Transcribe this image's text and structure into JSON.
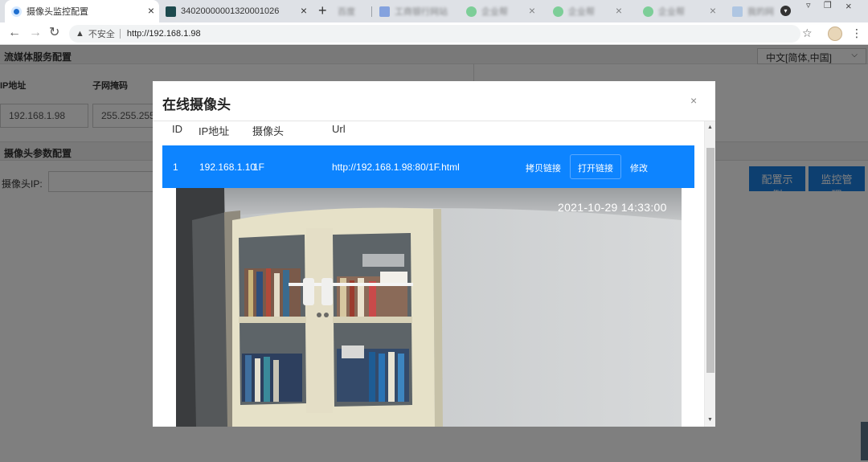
{
  "browser": {
    "tabs": [
      {
        "title": "摄像头监控配置",
        "active": true
      },
      {
        "title": "340200000013200010​26"
      },
      {
        "title": "百度"
      },
      {
        "title": "工商银行网站"
      },
      {
        "title": "企业帮"
      },
      {
        "title": "企业帮"
      },
      {
        "title": "企业帮"
      },
      {
        "title": "我的网"
      }
    ],
    "address": {
      "security_label": "不安全",
      "url": "http://192.168.1.98"
    }
  },
  "page": {
    "section1_title": "流媒体服务配置",
    "language_select": "中文[简体,中国]",
    "ip_label": "IP地址",
    "subnet_label": "子网掩码",
    "ip_value": "192.168.1.98",
    "subnet_value": "255.255.255",
    "section2_title": "摄像头参数配置",
    "camera_ip_label": "摄像头IP:",
    "config_example_button": "配置示例",
    "monitor_manage_button": "监控管理"
  },
  "modal": {
    "title": "在线摄像头",
    "close": "×",
    "columns": {
      "id": "ID",
      "ip": "IP地址",
      "camera": "摄像头",
      "url": "Url"
    },
    "rows": [
      {
        "id": "1",
        "ip": "192.168.1.10",
        "camera": "1F",
        "url": "http://192.168.1.98:80/1F.html",
        "copy_link": "拷贝链接",
        "open_link": "打开链接",
        "edit": "修改"
      }
    ],
    "camera_timestamp": "2021-10-29 14:33:00"
  },
  "colors": {
    "selected_row": "#0d84ff",
    "primary_button": "#1a7ee0"
  }
}
